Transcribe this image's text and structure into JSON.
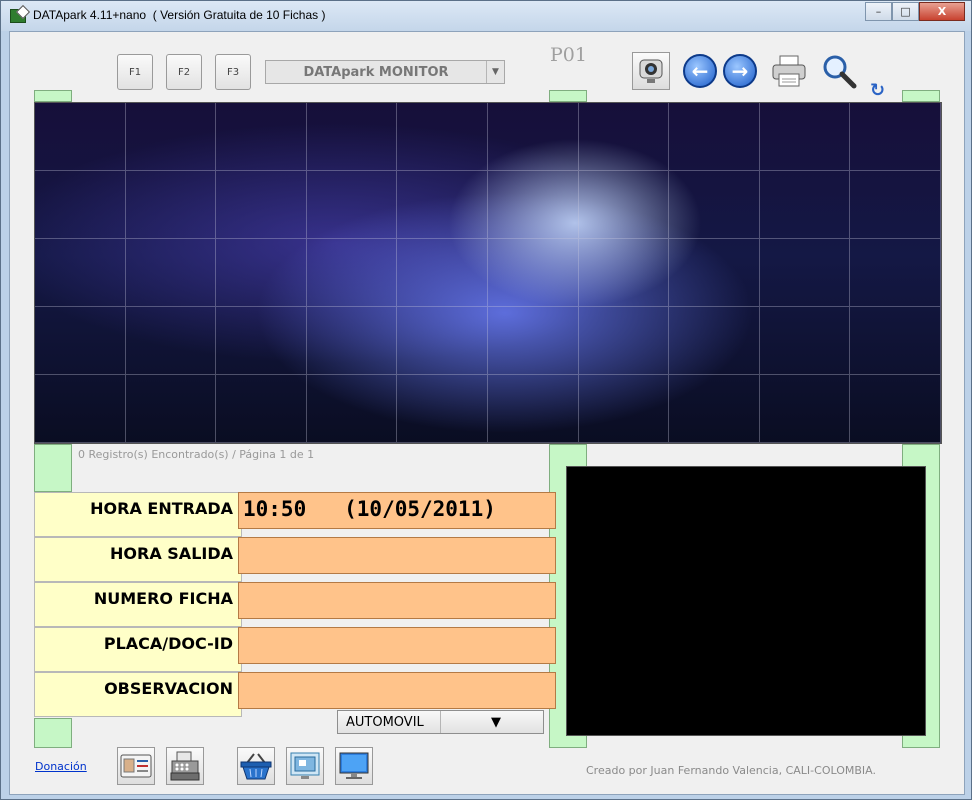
{
  "window": {
    "title": "DATApark 4.11+nano  ( Versión Gratuita de 10 Fichas )",
    "minimize": "–",
    "maximize": "□",
    "close": "X"
  },
  "toolbar": {
    "function_keys": [
      "F1",
      "F2",
      "F3"
    ],
    "monitor_select": "DATApark MONITOR",
    "position_code": "P01",
    "icons": [
      "webcam-icon",
      "back-arrow-icon",
      "forward-arrow-icon",
      "printer-icon",
      "magnifier-icon",
      "refresh-icon"
    ]
  },
  "records_status": "0 Registro(s) Encontrado(s) / Página 1 de 1",
  "form": {
    "fields": [
      {
        "label": "HORA ENTRADA",
        "value": "10:50   (10/05/2011)"
      },
      {
        "label": "HORA SALIDA",
        "value": ""
      },
      {
        "label": "NUMERO FICHA",
        "value": ""
      },
      {
        "label": "PLACA/DOC-ID",
        "value": ""
      },
      {
        "label": "OBSERVACION",
        "value": ""
      }
    ],
    "vehicle_type": "AUTOMOVIL"
  },
  "footer": {
    "donation_link": "Donación",
    "credit": "Creado por Juan Fernando Valencia, CALI-COLOMBIA.",
    "icons": [
      "id-card-icon",
      "cash-register-icon",
      "basket-icon",
      "screen-capture-icon",
      "monitor-icon"
    ]
  },
  "colors": {
    "label_bg": "#ffffc8",
    "value_bg": "#ffc38a",
    "side_panel": "#c6f7c6"
  }
}
